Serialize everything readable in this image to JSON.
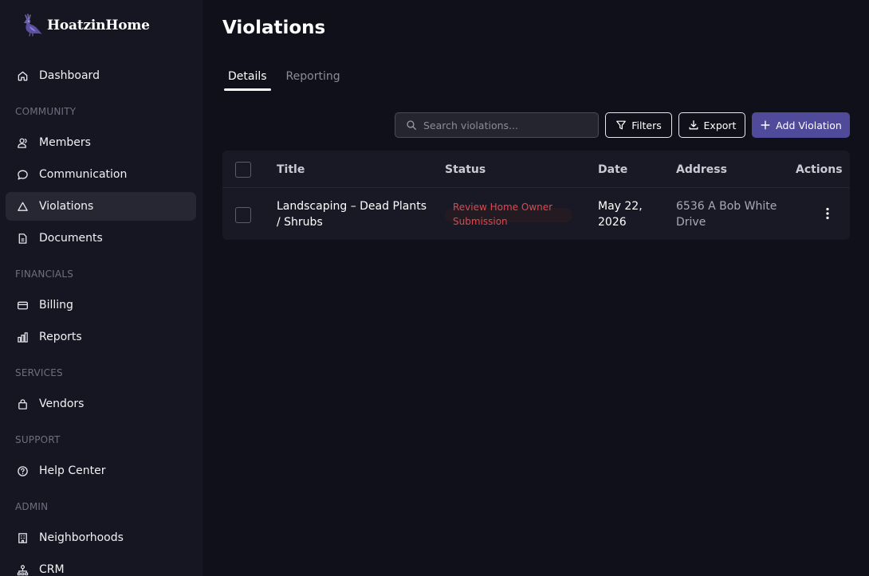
{
  "brand": {
    "name": "HoatzinHome"
  },
  "sidebar": {
    "items": [
      {
        "label": "Dashboard",
        "icon": "home-icon"
      },
      {
        "label": "Members",
        "icon": "users-icon"
      },
      {
        "label": "Communication",
        "icon": "message-icon"
      },
      {
        "label": "Violations",
        "icon": "warning-triangle-icon",
        "active": true
      },
      {
        "label": "Documents",
        "icon": "document-icon"
      },
      {
        "label": "Billing",
        "icon": "credit-card-icon"
      },
      {
        "label": "Reports",
        "icon": "bar-chart-icon"
      },
      {
        "label": "Vendors",
        "icon": "shopping-bag-icon"
      },
      {
        "label": "Help Center",
        "icon": "help-circle-icon"
      },
      {
        "label": "Neighborhoods",
        "icon": "building-icon"
      },
      {
        "label": "CRM",
        "icon": "network-icon"
      }
    ],
    "sections": {
      "community": "COMMUNITY",
      "financials": "FINANCIALS",
      "services": "SERVICES",
      "support": "SUPPORT",
      "admin": "ADMIN"
    }
  },
  "page": {
    "title": "Violations"
  },
  "tabs": [
    {
      "label": "Details",
      "active": true
    },
    {
      "label": "Reporting",
      "active": false
    }
  ],
  "toolbar": {
    "search_placeholder": "Search violations...",
    "filters_label": "Filters",
    "export_label": "Export",
    "add_label": "Add Violation"
  },
  "table": {
    "columns": [
      "Title",
      "Status",
      "Date",
      "Address",
      "Actions"
    ],
    "rows": [
      {
        "title_line1": "Landscaping – Dead Plants",
        "title_line2": "/ Shrubs",
        "status_line1": "Review Home Owner",
        "status_line2": "Submission",
        "date_line1": "May 22,",
        "date_line2": "2026",
        "address_line1": "6536 A Bob White",
        "address_line2": "Drive"
      }
    ]
  },
  "colors": {
    "background": "#0f1019",
    "sidebar": "#151621",
    "accent": "#4f4b9a",
    "status_red": "#e2474d"
  }
}
